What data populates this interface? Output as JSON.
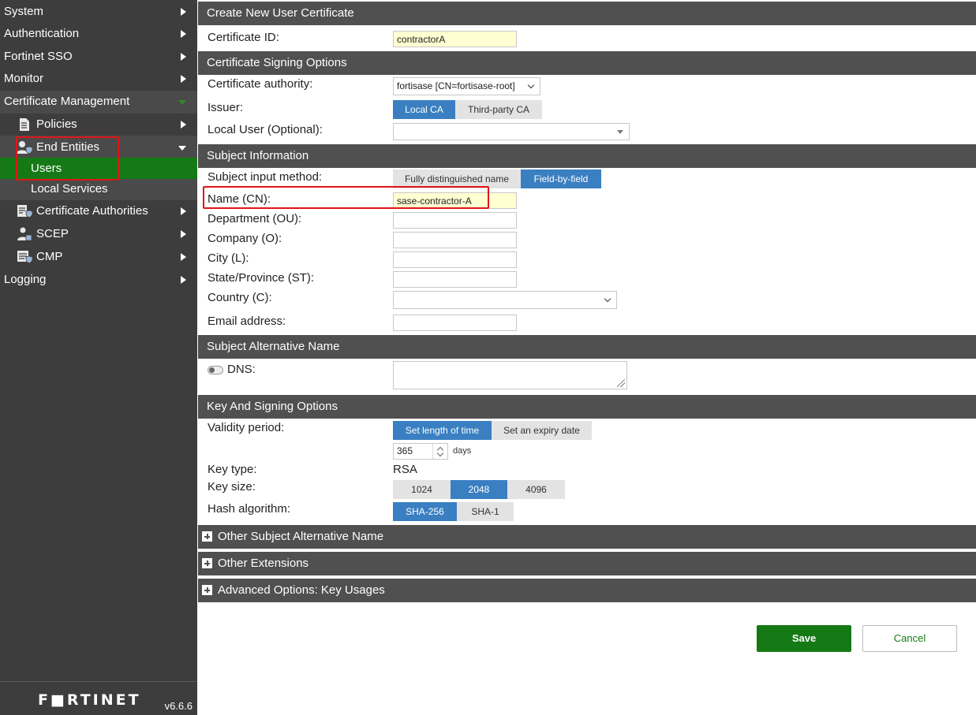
{
  "sidebar": {
    "items": [
      {
        "label": "System"
      },
      {
        "label": "Authentication"
      },
      {
        "label": "Fortinet SSO"
      },
      {
        "label": "Monitor"
      },
      {
        "label": "Certificate Management"
      },
      {
        "label": "Policies"
      },
      {
        "label": "End Entities"
      },
      {
        "label": "Users"
      },
      {
        "label": "Local Services"
      },
      {
        "label": "Certificate Authorities"
      },
      {
        "label": "SCEP"
      },
      {
        "label": "CMP"
      },
      {
        "label": "Logging"
      }
    ],
    "brand": "F■RTINET",
    "version": "v6.6.6"
  },
  "form": {
    "title": "Create New User Certificate",
    "certificate_id": {
      "label": "Certificate ID:",
      "value": "contractorA"
    },
    "signing": {
      "title": "Certificate Signing Options",
      "ca_label": "Certificate authority:",
      "ca_value": "fortisase [CN=fortisase-root]",
      "issuer_label": "Issuer:",
      "issuer_options": [
        "Local CA",
        "Third-party CA"
      ],
      "local_user_label": "Local User (Optional):",
      "local_user_value": ""
    },
    "subject": {
      "title": "Subject Information",
      "method_label": "Subject input method:",
      "method_options": [
        "Fully distinguished name",
        "Field-by-field"
      ],
      "cn_label": "Name (CN):",
      "cn_value": "sase-contractor-A",
      "ou_label": "Department (OU):",
      "o_label": "Company (O):",
      "l_label": "City (L):",
      "st_label": "State/Province (ST):",
      "c_label": "Country (C):",
      "email_label": "Email address:"
    },
    "san": {
      "title": "Subject Alternative Name",
      "dns_label": "DNS:"
    },
    "key": {
      "title": "Key And Signing Options",
      "validity_label": "Validity period:",
      "validity_options": [
        "Set length of time",
        "Set an expiry date"
      ],
      "days_value": "365",
      "days_unit": "days",
      "type_label": "Key type:",
      "type_value": "RSA",
      "size_label": "Key size:",
      "size_options": [
        "1024",
        "2048",
        "4096"
      ],
      "hash_label": "Hash algorithm:",
      "hash_options": [
        "SHA-256",
        "SHA-1"
      ]
    },
    "collapsed": [
      {
        "label": "Other Subject Alternative Name"
      },
      {
        "label": "Other Extensions"
      },
      {
        "label": "Advanced Options: Key Usages"
      }
    ],
    "save_label": "Save",
    "cancel_label": "Cancel"
  },
  "colors": {
    "sidebar_bg": "#3d3d3d",
    "active_green": "#157a15",
    "section_header": "#505050",
    "segment_selected": "#3a7fc1",
    "input_highlight": "#ffffd2",
    "annotation_red": "#e01515"
  }
}
